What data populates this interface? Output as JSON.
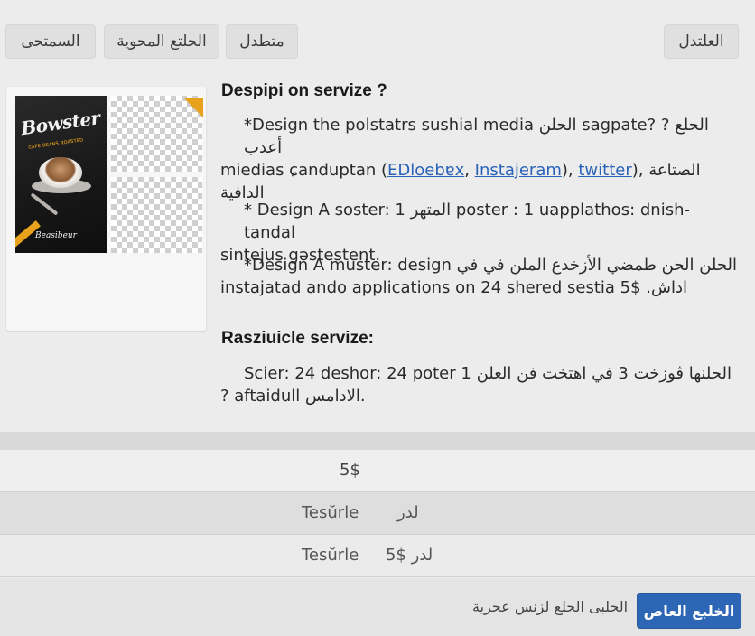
{
  "topbar": {
    "buttons_left": [
      "السمتحى",
      "الحلتع المحوية",
      "متطدل"
    ],
    "button_right": "العلتدل"
  },
  "thumbnail": {
    "poster_title": "Bowster",
    "poster_subtitle": "ᴄᴀꜰᴇ ʙᴇᴀɴꜱ ʀᴏᴀꜱᴛᴇᴅ",
    "poster_footer": "Beasibeur"
  },
  "section1": {
    "title": "Despipi on servize ?",
    "p1_line1": "*Design the polstatrs sushial media الحلن sagpate? ? الحلع أعدب",
    "p1_line2_pre": "miedias ɕanduptan (",
    "link_edloebax": "EDloebɐx",
    "sep1": ", ",
    "link_instajeram": "Instajeram",
    "sep2": "), ",
    "link_twitter": "twitter",
    "p1_line2_post": "), الصتاعة الدافية",
    "p2_line1": "* Design A soster: 1 المتهر poster : 1 uapplathos: dnish-tandal",
    "p2_line2": "sintejus gəstestent.",
    "p3_line1": "*Design A muster: design الحلن الحن طمضي الأزخدع الملن في في",
    "p3_line2": "instajatad ando applications on 24 shered sestia 5$ .اداش"
  },
  "section2": {
    "title": "Rasziuicle servize:",
    "p4_line1": "Scier: 24 deshor: 24 poter 1 الحلنها ڤوزخت 3 في اهتخت فن العلن",
    "p4_line2": "? aftaidull الادامس."
  },
  "price_table": {
    "row1_value": "5$",
    "row2_label": "Tesŭrle",
    "row2_value": "لدر",
    "row3_label": "Tesŭrle",
    "row3_value": "5$ لدر"
  },
  "footer": {
    "secondary_text": "الحلبى الحلع لزنس عحرية",
    "primary_button": "الخلبع العاص"
  },
  "colors": {
    "accent": "#2d66b5",
    "link": "#2a62b8",
    "poster_accent": "#e8a21b"
  }
}
